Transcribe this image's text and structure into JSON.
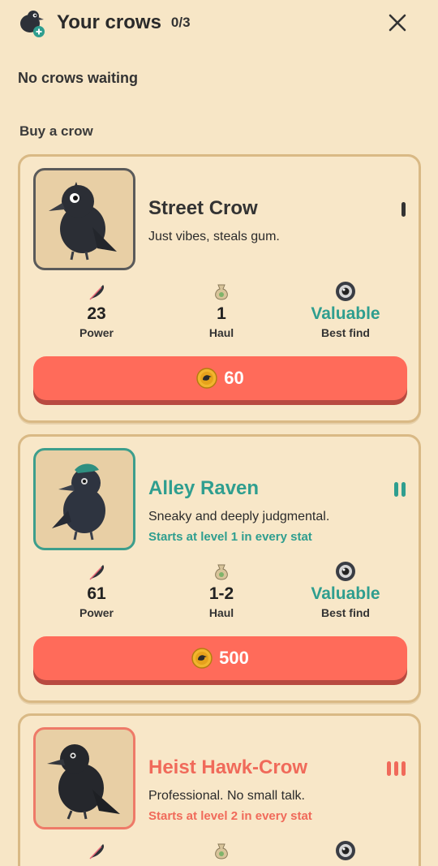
{
  "header": {
    "title": "Your crows",
    "count": "0/3",
    "logo_icon": "crow-add-icon",
    "close_icon": "close-icon"
  },
  "status": {
    "waiting": "No crows waiting"
  },
  "shop": {
    "title": "Buy a crow",
    "crows": [
      {
        "name": "Street Crow",
        "description": "Just vibes, steals gum.",
        "note": "",
        "tier": 1,
        "accent": "#333333",
        "frame": "#5a5a5a",
        "stats": {
          "power": "23",
          "haul": "1",
          "best_find": "Valuable"
        },
        "labels": {
          "power": "Power",
          "haul": "Haul",
          "best_find": "Best find"
        },
        "price": "60"
      },
      {
        "name": "Alley Raven",
        "description": "Sneaky and deeply judgmental.",
        "note": "Starts at level 1 in every stat",
        "tier": 2,
        "accent": "#2f9e8f",
        "frame": "#3d9e8c",
        "stats": {
          "power": "61",
          "haul": "1-2",
          "best_find": "Valuable"
        },
        "labels": {
          "power": "Power",
          "haul": "Haul",
          "best_find": "Best find"
        },
        "price": "500"
      },
      {
        "name": "Heist Hawk-Crow",
        "description": "Professional. No small talk.",
        "note": "Starts at level 2 in every stat",
        "tier": 3,
        "accent": "#f06a5a",
        "frame": "#ee7a68",
        "stats": {
          "power": "",
          "haul": "",
          "best_find": ""
        },
        "labels": {
          "power": "",
          "haul": "",
          "best_find": ""
        },
        "price": ""
      }
    ]
  },
  "colors": {
    "background": "#f7e6c6",
    "card_border": "#d9b985",
    "buy_button": "#ff6b5a",
    "teal": "#2f9e8f",
    "coral": "#f06a5a"
  }
}
